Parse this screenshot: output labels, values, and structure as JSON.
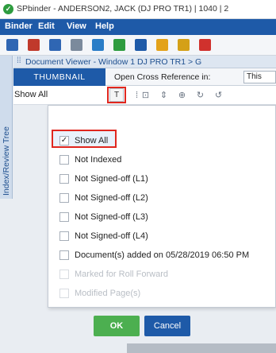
{
  "window": {
    "title": "SPbinder - ANDERSON2, JACK (DJ PRO TR1) | 1040 | 2"
  },
  "menu": [
    "Binder",
    "Edit",
    "View",
    "Help"
  ],
  "toolbar_icons": [
    {
      "name": "save-icon",
      "color": "#2f66b3"
    },
    {
      "name": "binder-icon",
      "color": "#c0392b"
    },
    {
      "name": "print-icon",
      "color": "#2f66b3"
    },
    {
      "name": "document-icon",
      "color": "#7b8a9c"
    },
    {
      "name": "page-icon",
      "color": "#2a7dc7"
    },
    {
      "name": "refresh-icon",
      "color": "#2e9c3f"
    },
    {
      "name": "sign-off-icon",
      "color": "#1e5aa8"
    },
    {
      "name": "cross-reference-icon",
      "color": "#e3a21a"
    },
    {
      "name": "user-icon",
      "color": "#d4a017"
    },
    {
      "name": "delete-icon",
      "color": "#d0312d"
    }
  ],
  "side_panel": {
    "label": "Index/Review Tree"
  },
  "viewer": {
    "title": "Document Viewer - Window 1   DJ PRO TR1 > G",
    "thumbnail_tab": "THUMBNAIL",
    "xref_label": "Open Cross Reference in:",
    "xref_value": "This"
  },
  "filter": {
    "label": "Show All",
    "button_glyph": "T"
  },
  "filter_options": [
    {
      "label": "Show All",
      "checked": true,
      "enabled": true
    },
    {
      "label": "Not Indexed",
      "checked": false,
      "enabled": true
    },
    {
      "label": "Not Signed-off (L1)",
      "checked": false,
      "enabled": true
    },
    {
      "label": "Not Signed-off (L2)",
      "checked": false,
      "enabled": true
    },
    {
      "label": "Not Signed-off (L3)",
      "checked": false,
      "enabled": true
    },
    {
      "label": "Not Signed-off (L4)",
      "checked": false,
      "enabled": true
    },
    {
      "label": "Document(s) added on 05/28/2019 06:50 PM",
      "checked": false,
      "enabled": true
    },
    {
      "label": "Marked for Roll Forward",
      "checked": false,
      "enabled": false
    },
    {
      "label": "Modified Page(s)",
      "checked": false,
      "enabled": false
    }
  ],
  "buttons": {
    "ok": "OK",
    "cancel": "Cancel"
  },
  "colors": {
    "accent": "#1e5aa8",
    "ok": "#4caf50",
    "highlight": "#e0271f"
  }
}
